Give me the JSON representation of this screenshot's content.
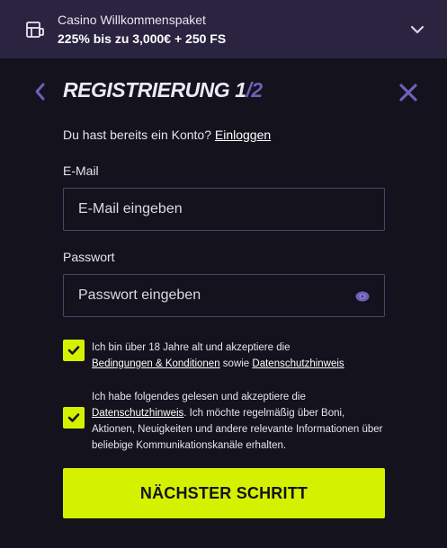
{
  "promo": {
    "icon": "gift-box-icon",
    "title": "Casino Willkommenspaket",
    "subtitle": "225% bis zu 3,000€ + 250 FS"
  },
  "header": {
    "title": "REGISTRIERUNG",
    "step_current": "1",
    "step_separator": "/",
    "step_total": "2"
  },
  "login": {
    "prompt": "Du hast bereits ein Konto?",
    "link_label": "Einloggen"
  },
  "email": {
    "label": "E-Mail",
    "placeholder": "E-Mail eingeben"
  },
  "password": {
    "label": "Passwort",
    "placeholder": "Passwort eingeben"
  },
  "consent_age": {
    "checked": true,
    "text_start": "Ich bin über 18 Jahre alt und akzeptiere die",
    "link_terms": "Bedingungen & Konditionen",
    "text_mid": "sowie",
    "link_privacy": "Datenschutzhinweis"
  },
  "consent_marketing": {
    "checked": true,
    "text_start": "Ich habe folgendes gelesen und akzeptiere die",
    "link_privacy": "Datenschutzhinweis",
    "text_end": ". Ich möchte regelmäßig über Boni, Aktionen, Neuigkeiten und andere relevante Informationen über beliebige Kommunikationskanäle erhalten."
  },
  "next_button": {
    "label": "NÄCHSTER SCHRITT"
  },
  "colors": {
    "accent": "#d4f200",
    "promo_bg": "#2a2440",
    "page_bg": "#14121c",
    "muted_purple": "#6e5fb8"
  }
}
